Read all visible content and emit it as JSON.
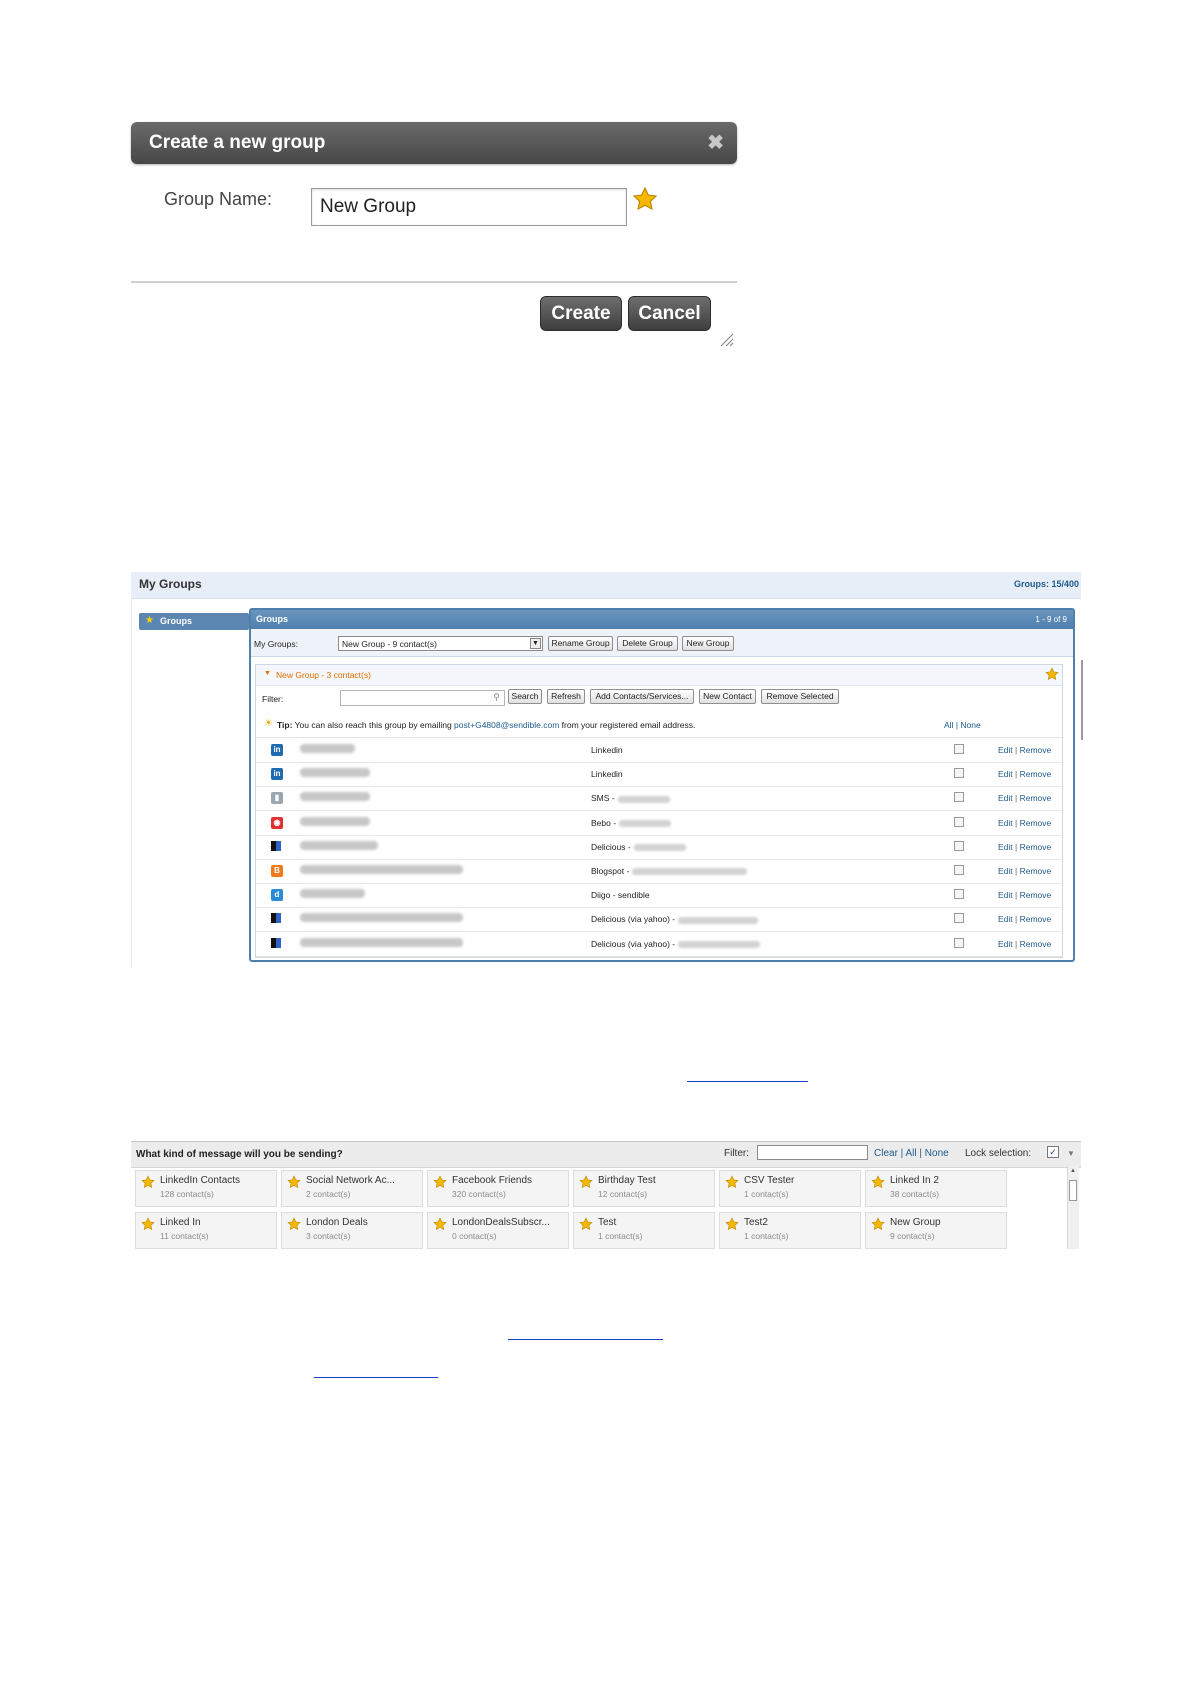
{
  "dialog": {
    "title": "Create a new group",
    "close_glyph": "✖",
    "group_name_label": "Group Name:",
    "group_name_value": "New Group",
    "create_label": "Create",
    "cancel_label": "Cancel"
  },
  "my_groups": {
    "title": "My Groups",
    "groups_count": "Groups: 15/400",
    "sidebar_tab": "Groups",
    "box_title": "Groups",
    "pagination": "1 - 9 of 9",
    "my_groups_label": "My Groups:",
    "selected_group": "New Group - 9 contact(s)",
    "toolbar_buttons": [
      "Rename Group",
      "Delete Group",
      "New Group"
    ],
    "group_header": "New Group - 3 contact(s)",
    "filter_label": "Filter:",
    "action_buttons": [
      "Search",
      "Refresh",
      "Add Contacts/Services...",
      "New Contact",
      "Remove Selected"
    ],
    "tip_bold": "Tip:",
    "tip_text_1": " You can also reach this group by emailing ",
    "tip_email": "post+G4808@sendible.com",
    "tip_text_2": " from your registered email address.",
    "all_label": "All",
    "none_label": "None",
    "edit_label": "Edit",
    "remove_label": "Remove",
    "rows": [
      {
        "icon": "linkedin-icon",
        "service": "Linkedin"
      },
      {
        "icon": "linkedin-icon",
        "service": "Linkedin"
      },
      {
        "icon": "sms-icon",
        "service": "SMS -"
      },
      {
        "icon": "bebo-icon",
        "service": "Bebo -"
      },
      {
        "icon": "delicious-icon",
        "service": "Delicious -"
      },
      {
        "icon": "blogger-icon",
        "service": "Blogspot -"
      },
      {
        "icon": "diigo-icon",
        "service": "Diigo - sendible"
      },
      {
        "icon": "delicious-icon",
        "service": "Delicious (via yahoo) -"
      },
      {
        "icon": "delicious-icon",
        "service": "Delicious (via yahoo) -"
      }
    ]
  },
  "message_kind": {
    "title": "What kind of message will you be sending?",
    "filter_label": "Filter:",
    "clear": "Clear",
    "all": "All",
    "none": "None",
    "lock_label": "Lock selection:",
    "lock_checked": "✓",
    "tiles": [
      {
        "name": "LinkedIn Contacts",
        "count": "128 contact(s)"
      },
      {
        "name": "Social Network Ac...",
        "count": "2 contact(s)"
      },
      {
        "name": "Facebook Friends",
        "count": "320 contact(s)"
      },
      {
        "name": "Birthday Test",
        "count": "12 contact(s)"
      },
      {
        "name": "CSV Tester",
        "count": "1 contact(s)"
      },
      {
        "name": "Linked In 2",
        "count": "38 contact(s)"
      },
      {
        "name": "Linked In",
        "count": "11 contact(s)"
      },
      {
        "name": "London Deals",
        "count": "3 contact(s)"
      },
      {
        "name": "LondonDealsSubscr...",
        "count": "0 contact(s)"
      },
      {
        "name": "Test",
        "count": "1 contact(s)"
      },
      {
        "name": "Test2",
        "count": "1 contact(s)"
      },
      {
        "name": "New Group",
        "count": "9 contact(s)"
      }
    ]
  },
  "colors": {
    "dialog_bar": "#5a5a5a",
    "panel_blue": "#4f7fad",
    "link_blue": "#1f5a8c",
    "accent_orange": "#e06d00",
    "star": "#f5b800"
  }
}
